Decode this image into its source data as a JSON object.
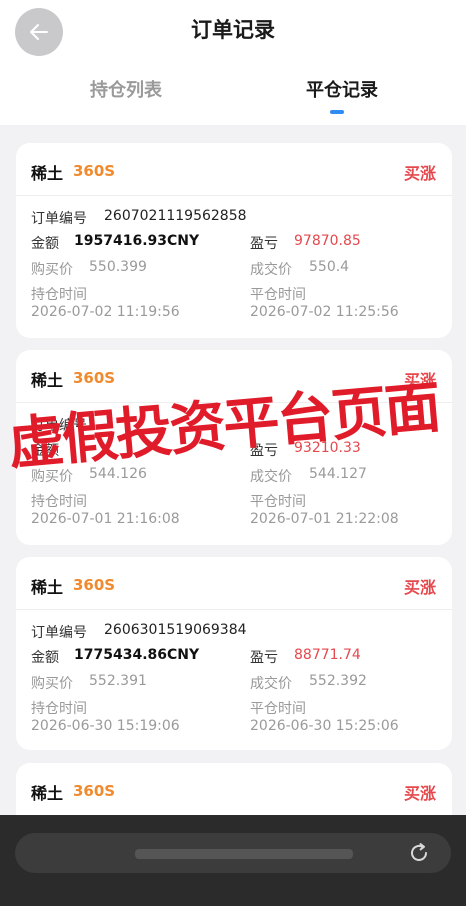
{
  "header": {
    "title": "订单记录",
    "tabs": [
      "持仓列表",
      "平仓记录"
    ]
  },
  "labels": {
    "order_no": "订单编号",
    "amount": "金额",
    "pnl": "盈亏",
    "buy_price": "购买价",
    "deal_price": "成交价",
    "open_time": "持仓时间",
    "close_time": "平仓时间"
  },
  "orders": [
    {
      "symbol": "稀土",
      "period": "360S",
      "direction": "买涨",
      "order_no": "2607021119562858",
      "amount": "1957416.93CNY",
      "pnl": "97870.85",
      "buy_price": "550.399",
      "deal_price": "550.4",
      "open_time": "2026-07-02 11:19:56",
      "close_time": "2026-07-02 11:25:56"
    },
    {
      "symbol": "稀土",
      "period": "360S",
      "direction": "买涨",
      "pnl": "93210.33",
      "buy_price": "544.126",
      "deal_price": "544.127",
      "open_time": "2026-07-01 21:16:08",
      "close_time": "2026-07-01 21:22:08"
    },
    {
      "symbol": "稀土",
      "period": "360S",
      "direction": "买涨",
      "order_no": "2606301519069384",
      "amount": "1775434.86CNY",
      "pnl": "88771.74",
      "buy_price": "552.391",
      "deal_price": "552.392",
      "open_time": "2026-06-30 15:19:06",
      "close_time": "2026-06-30 15:25:06"
    },
    {
      "symbol": "稀土",
      "period": "360S",
      "direction": "买涨"
    }
  ],
  "overlay_text": "虚假投资平台页面",
  "colors": {
    "accent_orange": "#f08a2c",
    "red": "#e5484d",
    "tab_indicator": "#2f8cf5",
    "overlay_red": "#e11c2a"
  }
}
